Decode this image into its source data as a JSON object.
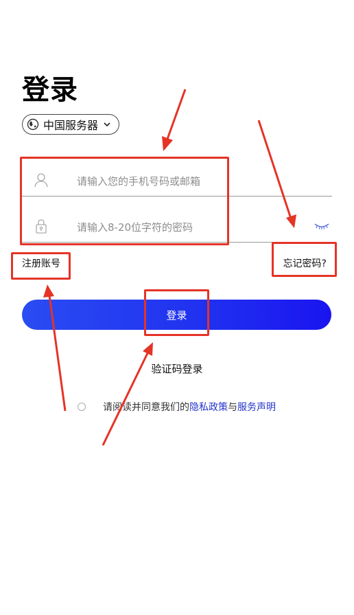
{
  "page": {
    "title": "登录"
  },
  "server": {
    "label": "中国服务器",
    "icon": "globe-icon"
  },
  "form": {
    "phone_placeholder": "请输入您的手机号码或邮箱",
    "password_placeholder": "请输入8-20位字符的密码"
  },
  "links": {
    "register": "注册账号",
    "forgot": "忘记密码?"
  },
  "actions": {
    "login_label": "登录",
    "code_login_label": "验证码登录"
  },
  "agreement": {
    "prefix": "请阅读并同意我们的 ",
    "privacy": "隐私政策",
    "and": "与",
    "service": "服务声明"
  },
  "colors": {
    "accent_start": "#2a4cf2",
    "accent_end": "#1a14f0",
    "link": "#2435c9",
    "annotation": "#e53326"
  }
}
